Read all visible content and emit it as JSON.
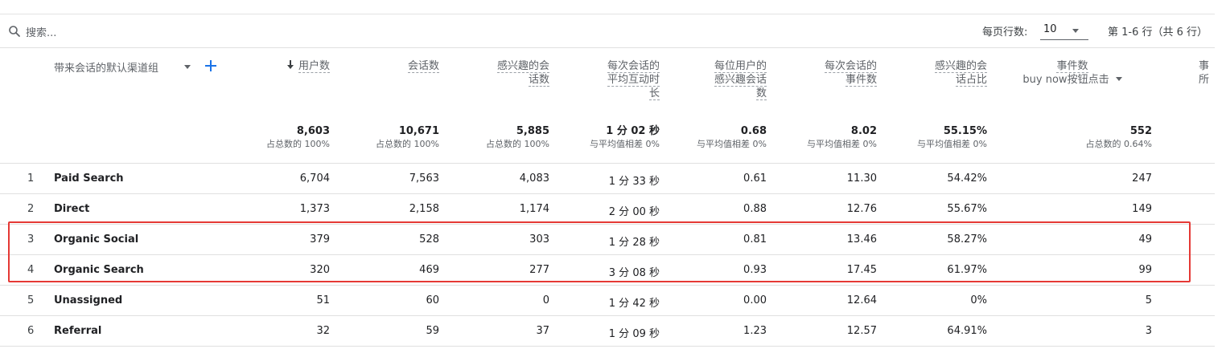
{
  "toolbar": {
    "search_placeholder": "搜索...",
    "rows_per_page_label": "每页行数:",
    "rows_per_page_value": "10",
    "page_info": "第 1-6 行（共 6 行）"
  },
  "headers": {
    "dimension": "带来会话的默认渠道组",
    "users": "用户数",
    "sessions": "会话数",
    "engaged_sessions": [
      "感兴趣的会",
      "话数"
    ],
    "avg_engagement_time": [
      "每次会话的",
      "平均互动时",
      "长"
    ],
    "engaged_sessions_per_user": [
      "每位用户的",
      "感兴趣会话",
      "数"
    ],
    "events_per_session": [
      "每次会话的",
      "事件数"
    ],
    "engagement_rate": [
      "感兴趣的会",
      "话占比"
    ],
    "event_count": "事件数",
    "event_filter": "buy now按钮点击",
    "cut_off": [
      "事",
      "所"
    ]
  },
  "totals": {
    "users": "8,603",
    "users_sub": "占总数的 100%",
    "sessions": "10,671",
    "sessions_sub": "占总数的 100%",
    "engaged_sessions": "5,885",
    "engaged_sessions_sub": "占总数的 100%",
    "avg_engagement_time": "1 分 02 秒",
    "avg_engagement_time_sub": "与平均值相差 0%",
    "engaged_sessions_per_user": "0.68",
    "engaged_sessions_per_user_sub": "与平均值相差 0%",
    "events_per_session": "8.02",
    "events_per_session_sub": "与平均值相差 0%",
    "engagement_rate": "55.15%",
    "engagement_rate_sub": "与平均值相差 0%",
    "event_count": "552",
    "event_count_sub": "占总数的 0.64%"
  },
  "rows": [
    {
      "idx": "1",
      "name": "Paid Search",
      "users": "6,704",
      "sessions": "7,563",
      "engaged": "4,083",
      "avg_time": "1 分 33 秒",
      "per_user": "0.61",
      "events_per_session": "11.30",
      "rate": "54.42%",
      "event_count": "247"
    },
    {
      "idx": "2",
      "name": "Direct",
      "users": "1,373",
      "sessions": "2,158",
      "engaged": "1,174",
      "avg_time": "2 分 00 秒",
      "per_user": "0.88",
      "events_per_session": "12.76",
      "rate": "55.67%",
      "event_count": "149"
    },
    {
      "idx": "3",
      "name": "Organic Social",
      "users": "379",
      "sessions": "528",
      "engaged": "303",
      "avg_time": "1 分 28 秒",
      "per_user": "0.81",
      "events_per_session": "13.46",
      "rate": "58.27%",
      "event_count": "49"
    },
    {
      "idx": "4",
      "name": "Organic Search",
      "users": "320",
      "sessions": "469",
      "engaged": "277",
      "avg_time": "3 分 08 秒",
      "per_user": "0.93",
      "events_per_session": "17.45",
      "rate": "61.97%",
      "event_count": "99"
    },
    {
      "idx": "5",
      "name": "Unassigned",
      "users": "51",
      "sessions": "60",
      "engaged": "0",
      "avg_time": "1 分 42 秒",
      "per_user": "0.00",
      "events_per_session": "12.64",
      "rate": "0%",
      "event_count": "5"
    },
    {
      "idx": "6",
      "name": "Referral",
      "users": "32",
      "sessions": "59",
      "engaged": "37",
      "avg_time": "1 分 09 秒",
      "per_user": "1.23",
      "events_per_session": "12.57",
      "rate": "64.91%",
      "event_count": "3"
    }
  ],
  "colors": {
    "accent": "#1a73e8",
    "highlight_border": "#e53935",
    "rule": "#e0e0e0",
    "muted_text": "#5f6368"
  },
  "icons": [
    "search-icon",
    "plus-icon",
    "sort-down-arrow-icon",
    "chevron-down-icon"
  ]
}
